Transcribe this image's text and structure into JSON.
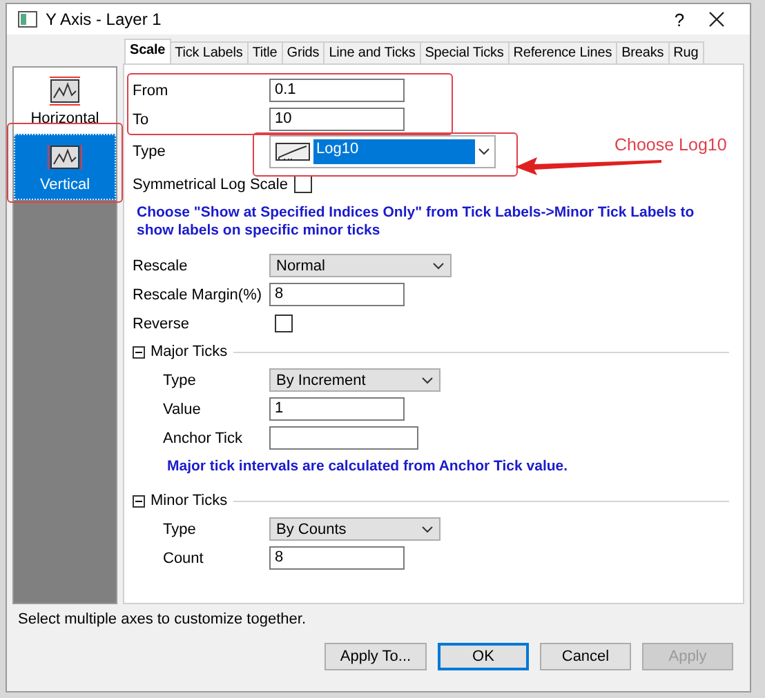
{
  "window": {
    "title": "Y Axis - Layer 1",
    "help": "?"
  },
  "sidebar": {
    "items": [
      {
        "label": "Horizontal",
        "selected": false
      },
      {
        "label": "Vertical",
        "selected": true
      }
    ]
  },
  "tabs": [
    {
      "label": "Scale",
      "selected": true
    },
    {
      "label": "Tick Labels",
      "selected": false
    },
    {
      "label": "Title",
      "selected": false
    },
    {
      "label": "Grids",
      "selected": false
    },
    {
      "label": "Line and Ticks",
      "selected": false
    },
    {
      "label": "Special Ticks",
      "selected": false
    },
    {
      "label": "Reference Lines",
      "selected": false
    },
    {
      "label": "Breaks",
      "selected": false
    },
    {
      "label": "Rug",
      "selected": false
    }
  ],
  "scale_rows": [
    {
      "kind": "input",
      "label": "From",
      "value": "0.1"
    },
    {
      "kind": "input",
      "label": "To",
      "value": "10"
    },
    {
      "kind": "typeselect",
      "label": "Type",
      "value": "Log10"
    },
    {
      "kind": "checkbox",
      "label": "Symmetrical Log Scale",
      "checked": false
    },
    {
      "kind": "note",
      "text": "Choose \"Show at Specified Indices Only\" from Tick Labels->Minor Tick Labels to show labels on specific minor ticks"
    },
    {
      "kind": "select",
      "label": "Rescale",
      "value": "Normal"
    },
    {
      "kind": "input",
      "label": "Rescale Margin(%)",
      "value": "8"
    },
    {
      "kind": "checkbox",
      "label": "Reverse",
      "checked": false
    }
  ],
  "sections": [
    {
      "title": "Major Ticks",
      "expanded": true,
      "rows": [
        {
          "kind": "select",
          "label": "Type",
          "value": "By Increment"
        },
        {
          "kind": "input",
          "label": "Value",
          "value": "1"
        },
        {
          "kind": "input",
          "label": "Anchor Tick",
          "value": ""
        },
        {
          "kind": "note",
          "text": "Major tick intervals are calculated from Anchor Tick value."
        }
      ]
    },
    {
      "title": "Minor Ticks",
      "expanded": true,
      "rows": [
        {
          "kind": "select",
          "label": "Type",
          "value": "By Counts"
        },
        {
          "kind": "input",
          "label": "Count",
          "value": "8"
        }
      ]
    }
  ],
  "status_text": "Select multiple axes to customize together.",
  "buttons": [
    {
      "label": "Apply To...",
      "default": false,
      "disabled": false
    },
    {
      "label": "OK",
      "default": true,
      "disabled": false
    },
    {
      "label": "Cancel",
      "default": false,
      "disabled": false
    },
    {
      "label": "Apply",
      "default": false,
      "disabled": true
    }
  ],
  "annotation": {
    "text": "Choose Log10"
  }
}
